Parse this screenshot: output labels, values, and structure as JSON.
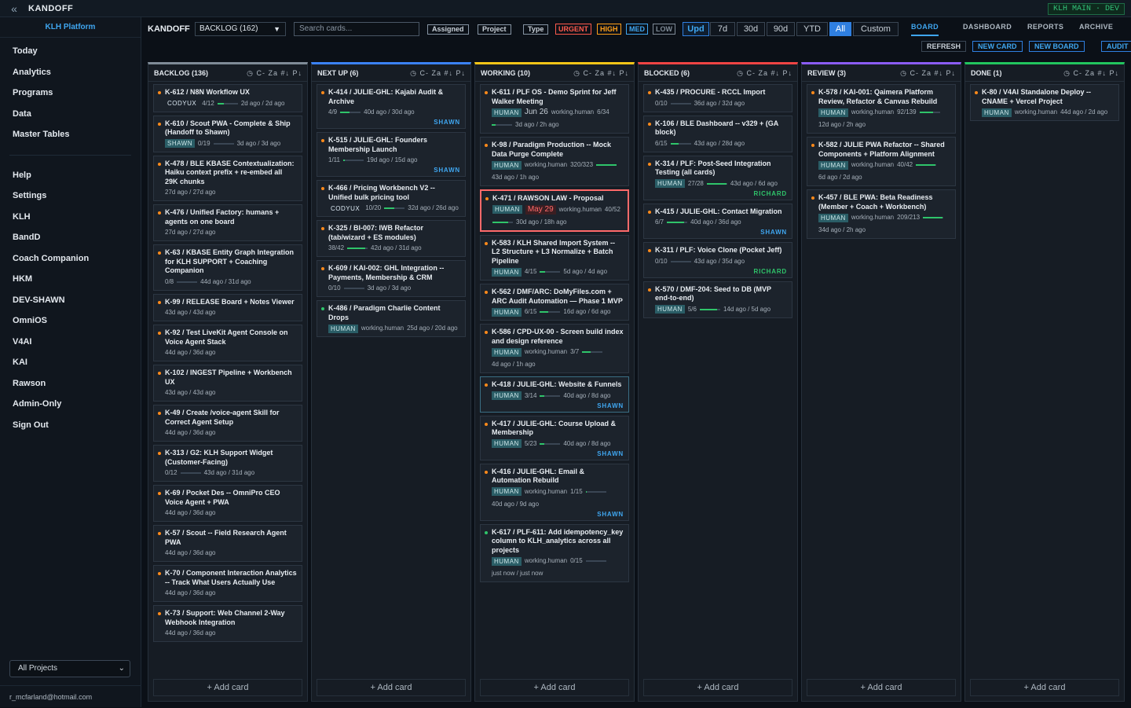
{
  "app": {
    "name": "KANDOFF",
    "env": "KLH MAIN · DEV"
  },
  "sidebar": {
    "platform": "KLH Platform",
    "items1": [
      "Today",
      "Analytics",
      "Programs",
      "Data",
      "Master Tables"
    ],
    "items2": [
      "Help",
      "Settings",
      "KLH",
      "BandD",
      "Coach Companion",
      "HKM",
      "DEV-SHAWN",
      "OmniOS",
      "V4AI",
      "KAI",
      "Rawson",
      "Admin-Only",
      "Sign Out"
    ],
    "project_select": "All Projects",
    "user": "r_mcfarland@hotmail.com"
  },
  "header": {
    "brand": "KANDOFF",
    "board_select": "BACKLOG (162)",
    "search_placeholder": "Search cards...",
    "filters": [
      "Assigned",
      "Project",
      "Type"
    ],
    "priorities": [
      {
        "label": "URGENT",
        "color": "#ff5a4d"
      },
      {
        "label": "HIGH",
        "color": "#ff9f1a"
      },
      {
        "label": "MED",
        "color": "#3fa6f0"
      },
      {
        "label": "LOW",
        "color": "#7f8b97"
      }
    ],
    "upd": "Upd",
    "ranges": [
      "7d",
      "30d",
      "90d",
      "YTD",
      "All",
      "Custom"
    ],
    "active_range": "All",
    "tabs": [
      "BOARD",
      "DASHBOARD",
      "REPORTS",
      "ARCHIVE"
    ],
    "active_tab": "BOARD",
    "actions": [
      "REFRESH",
      "NEW CARD",
      "NEW BOARD",
      "AUDIT"
    ]
  },
  "column_tools": "◷ C- Za #↓ P↓",
  "add_card": "+ Add card",
  "columns": [
    {
      "title": "BACKLOG (136)",
      "color": "#7f8b97",
      "cards": [
        {
          "t": "K-612 / N8N Workflow UX",
          "tag": "CODYUX",
          "prog": "4/12",
          "p": 33,
          "time": "2d ago / 2d ago",
          "dot": "#ff8a1a"
        },
        {
          "t": "K-610 / Scout PWA - Complete & Ship (Handoff to Shawn)",
          "tag": "SHAWN",
          "prog": "0/19",
          "p": 0,
          "time": "3d ago / 3d ago",
          "dot": "#ff8a1a"
        },
        {
          "t": "K-478 / BLE KBASE Contextualization: Haiku context prefix + re-embed all 29K chunks",
          "time": "27d ago / 27d ago",
          "dot": "#ff8a1a"
        },
        {
          "t": "K-476 / Unified Factory: humans + agents on one board",
          "time": "27d ago / 27d ago",
          "dot": "#ff8a1a"
        },
        {
          "t": "K-63 / KBASE Entity Graph Integration for KLH SUPPORT + Coaching Companion",
          "prog": "0/8",
          "p": 0,
          "time": "44d ago / 31d ago",
          "dot": "#ff8a1a"
        },
        {
          "t": "K-99 / RELEASE Board + Notes Viewer",
          "time": "43d ago / 43d ago",
          "dot": "#ff8a1a"
        },
        {
          "t": "K-92 / Test LiveKit Agent Console on Voice Agent Stack",
          "time": "44d ago / 36d ago",
          "dot": "#ff8a1a"
        },
        {
          "t": "K-102 / INGEST Pipeline + Workbench UX",
          "time": "43d ago / 43d ago",
          "dot": "#ff8a1a"
        },
        {
          "t": "K-49 / Create /voice-agent Skill for Correct Agent Setup",
          "time": "44d ago / 36d ago",
          "dot": "#ff8a1a"
        },
        {
          "t": "K-313 / G2: KLH Support Widget (Customer-Facing)",
          "prog": "0/12",
          "p": 0,
          "time": "43d ago / 31d ago",
          "dot": "#ff8a1a"
        },
        {
          "t": "K-69 / Pocket Des -- OmniPro CEO Voice Agent + PWA",
          "time": "44d ago / 36d ago",
          "dot": "#ff8a1a"
        },
        {
          "t": "K-57 / Scout -- Field Research Agent PWA",
          "time": "44d ago / 36d ago",
          "dot": "#ff8a1a"
        },
        {
          "t": "K-70 / Component Interaction Analytics -- Track What Users Actually Use",
          "time": "44d ago / 36d ago",
          "dot": "#ff8a1a"
        },
        {
          "t": "K-73 / Support: Web Channel 2-Way Webhook Integration",
          "time": "44d ago / 36d ago",
          "dot": "#ff8a1a"
        }
      ]
    },
    {
      "title": "NEXT UP (6)",
      "color": "#3b82f6",
      "cards": [
        {
          "t": "K-414 / JULIE-GHL: Kajabi Audit & Archive",
          "prog": "4/9",
          "p": 44,
          "time": "40d ago / 30d ago",
          "owner": "SHAWN",
          "dot": "#ff8a1a"
        },
        {
          "t": "K-515 / JULIE-GHL: Founders Membership Launch",
          "prog": "1/11",
          "p": 9,
          "time": "19d ago / 15d ago",
          "owner": "SHAWN",
          "dot": "#ff8a1a"
        },
        {
          "t": "K-466 / Pricing Workbench V2 -- Unified bulk pricing tool",
          "tag": "CODYUX",
          "prog": "10/20",
          "p": 50,
          "time": "32d ago / 26d ago",
          "dot": "#ff8a1a"
        },
        {
          "t": "K-325 / BI-007: IWB Refactor (tab/wizard + ES modules)",
          "prog": "38/42",
          "p": 90,
          "time": "42d ago / 31d ago",
          "dot": "#ff8a1a"
        },
        {
          "t": "K-609 / KAI-002: GHL Integration -- Payments, Membership & CRM",
          "prog": "0/10",
          "p": 0,
          "time": "3d ago / 3d ago",
          "dot": "#ff8a1a"
        },
        {
          "t": "K-486 / Paradigm Charlie Content Drops",
          "tag": "HUMAN",
          "by": "working.human",
          "time": "25d ago / 20d ago",
          "dot": "#2fc46a"
        }
      ]
    },
    {
      "title": "WORKING (10)",
      "color": "#f5c518",
      "cards": [
        {
          "t": "K-611 / PLF OS - Demo Sprint for Jeff Walker Meeting",
          "tag": "HUMAN",
          "due": "Jun 26",
          "by": "working.human",
          "prog": "6/34",
          "p": 18,
          "time": "3d ago / 2h ago",
          "dot": "#ff8a1a"
        },
        {
          "t": "K-98 / Paradigm Production -- Mock Data Purge Complete",
          "tag": "HUMAN",
          "by": "working.human",
          "prog": "320/323",
          "p": 99,
          "time": "43d ago / 1h ago",
          "dot": "#ff8a1a"
        },
        {
          "t": "K-471 / RAWSON LAW - Proposal",
          "tag": "HUMAN",
          "due": "May 29",
          "duered": true,
          "by": "working.human",
          "prog": "40/52",
          "p": 77,
          "time": "30d ago / 18h ago",
          "dot": "#ff8a1a",
          "hl": true
        },
        {
          "t": "K-583 / KLH Shared Import System -- L2 Structure + L3 Normalize + Batch Pipeline",
          "tag": "HUMAN",
          "prog": "4/15",
          "p": 27,
          "time": "5d ago / 4d ago",
          "dot": "#ff8a1a"
        },
        {
          "t": "K-562 / DMF/ARC: DoMyFiles.com + ARC Audit Automation — Phase 1 MVP",
          "tag": "HUMAN",
          "prog": "6/15",
          "p": 40,
          "time": "16d ago / 6d ago",
          "dot": "#ff8a1a"
        },
        {
          "t": "K-586 / CPD-UX-00 - Screen build index and design reference",
          "tag": "HUMAN",
          "by": "working.human",
          "prog": "3/7",
          "p": 43,
          "time": "4d ago / 1h ago",
          "dot": "#ff8a1a"
        },
        {
          "t": "K-418 / JULIE-GHL: Website & Funnels",
          "tag": "HUMAN",
          "prog": "3/14",
          "p": 21,
          "time": "40d ago / 8d ago",
          "owner": "SHAWN",
          "dot": "#ff8a1a",
          "hlb": true
        },
        {
          "t": "K-417 / JULIE-GHL: Course Upload & Membership",
          "tag": "HUMAN",
          "prog": "5/23",
          "p": 22,
          "time": "40d ago / 8d ago",
          "owner": "SHAWN",
          "dot": "#ff8a1a"
        },
        {
          "t": "K-416 / JULIE-GHL: Email & Automation Rebuild",
          "tag": "HUMAN",
          "by": "working.human",
          "prog": "1/15",
          "p": 7,
          "time": "40d ago / 9d ago",
          "owner": "SHAWN",
          "dot": "#ff8a1a"
        },
        {
          "t": "K-617 / PLF-611: Add idempotency_key column to KLH_analytics across all projects",
          "tag": "HUMAN",
          "by": "working.human",
          "prog": "0/15",
          "p": 0,
          "time": "just now / just now",
          "dot": "#2fc46a"
        }
      ]
    },
    {
      "title": "BLOCKED (6)",
      "color": "#ef4444",
      "cards": [
        {
          "t": "K-435 / PROCURE - RCCL Import",
          "prog": "0/10",
          "p": 0,
          "time": "36d ago / 32d ago",
          "dot": "#ff8a1a"
        },
        {
          "t": "K-106 / BLE Dashboard -- v329 + (GA block)",
          "prog": "6/15",
          "p": 40,
          "time": "43d ago / 28d ago",
          "dot": "#ff8a1a"
        },
        {
          "t": "K-314 / PLF: Post-Seed Integration Testing (all cards)",
          "tag": "HUMAN",
          "prog": "27/28",
          "p": 96,
          "time": "43d ago / 6d ago",
          "owner": "RICHARD",
          "ownergreen": true,
          "dot": "#ff8a1a"
        },
        {
          "t": "K-415 / JULIE-GHL: Contact Migration",
          "prog": "6/7",
          "p": 86,
          "time": "40d ago / 36d ago",
          "owner": "SHAWN",
          "dot": "#ff8a1a"
        },
        {
          "t": "K-311 / PLF: Voice Clone (Pocket Jeff)",
          "prog": "0/10",
          "p": 0,
          "time": "43d ago / 35d ago",
          "owner": "RICHARD",
          "ownergreen": true,
          "dot": "#ff8a1a"
        },
        {
          "t": "K-570 / DMF-204: Seed to DB (MVP end-to-end)",
          "tag": "HUMAN",
          "prog": "5/6",
          "p": 83,
          "time": "14d ago / 5d ago",
          "dot": "#ff8a1a"
        }
      ]
    },
    {
      "title": "REVIEW (3)",
      "color": "#8b5cf6",
      "cards": [
        {
          "t": "K-578 / KAI-001: Qaimera Platform Review, Refactor & Canvas Rebuild",
          "tag": "HUMAN",
          "by": "working.human",
          "prog": "92/139",
          "p": 66,
          "time": "12d ago / 2h ago",
          "dot": "#ff8a1a"
        },
        {
          "t": "K-582 / JULIE PWA Refactor -- Shared Components + Platform Alignment",
          "tag": "HUMAN",
          "by": "working.human",
          "prog": "40/42",
          "p": 95,
          "time": "6d ago / 2d ago",
          "dot": "#ff8a1a"
        },
        {
          "t": "K-457 / BLE PWA: Beta Readiness (Member + Coach + Workbench)",
          "tag": "HUMAN",
          "by": "working.human",
          "prog": "209/213",
          "p": 98,
          "time": "34d ago / 2h ago",
          "dot": "#ff8a1a"
        }
      ]
    },
    {
      "title": "DONE (1)",
      "color": "#22c55e",
      "cards": [
        {
          "t": "K-80 / V4AI Standalone Deploy -- CNAME + Vercel Project",
          "tag": "HUMAN",
          "by": "working.human",
          "time": "44d ago / 2d ago",
          "dot": "#ff8a1a"
        }
      ]
    }
  ]
}
